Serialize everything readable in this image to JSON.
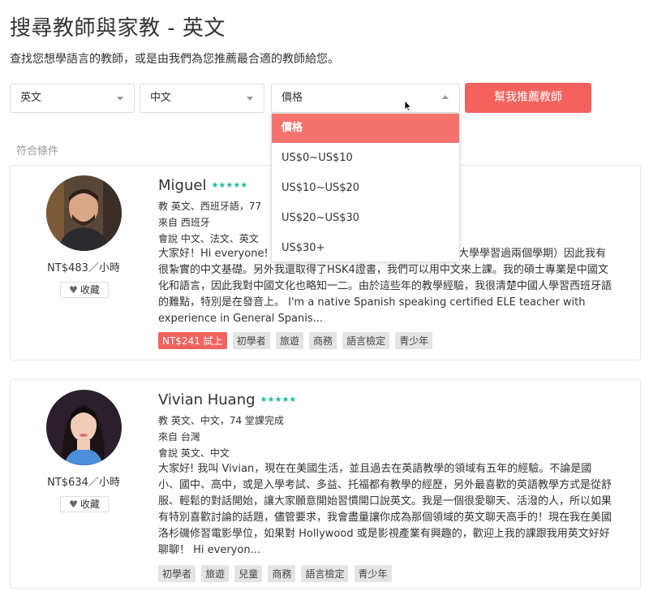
{
  "header": {
    "title": "搜尋教師與家教 - 英文",
    "subtitle": "查找您想學語言的教師，或是由我們為您推薦最合適的教師給您。"
  },
  "filters": {
    "language": "英文",
    "native": "中文",
    "price": "價格",
    "recommend_button": "幫我推薦教師",
    "price_options": [
      "價格",
      "US$0~US$10",
      "US$10~US$20",
      "US$20~US$30",
      "US$30+"
    ]
  },
  "results_label": "符合條件",
  "colors": {
    "accent": "#f4625e",
    "stars": "#1ebc9b"
  },
  "teachers": [
    {
      "name": "Miguel",
      "stars": "★★★★★",
      "teaches": "教 英文、西班牙語，77",
      "from": "來自  西班牙",
      "speaks": "會說  中文、法文、英文",
      "desc_l1": "大家好！Hi everyone!",
      "desc_l1b": "大學學習過兩個學期）因此我有",
      "desc_rest": "很紮實的中文基礎。另外我還取得了HSK4證書，我們可以用中文來上課。我的碩士專業是中國文化和語言，因此我對中國文化也略知一二。由於這些年的教學經驗，我很清楚中國人學習西班牙語的難點，特別是在發音上。  I'm a native Spanish speaking certified ELE teacher with experience in General Spanis...",
      "rate": "NT$483／小時",
      "fav": "收藏",
      "trial": "NT$241 試上",
      "tags": [
        "初學者",
        "旅遊",
        "商務",
        "語言檢定",
        "青少年"
      ]
    },
    {
      "name": "Vivian Huang",
      "stars": "★★★★★",
      "teaches": "教 英文、中文，74 堂課完成",
      "from": "來自  台灣",
      "speaks": "會說  英文、中文",
      "desc": "大家好! 我叫 Vivian，現在在美國生活，並且過去在英語教學的領域有五年的經驗。不論是國小、國中、高中，或是入學考試、多益、托福都有教學的經歷，另外最喜歡的英語教學方式是從舒服、輕鬆的對話開始，讓大家願意開始習慣開口說英文。我是一個很愛聊天、活潑的人，所以如果有特別喜歡討論的話題，儘管要求，我會盡量讓你成為那個領域的英文聊天高手的！現在我在美國洛杉磯修習電影學位，如果對 Hollywood 或是影視產業有興趣的，歡迎上我的課跟我用英文好好聊聊！  Hi everyon...",
      "rate": "NT$634／小時",
      "fav": "收藏",
      "tags": [
        "初學者",
        "旅遊",
        "兒童",
        "商務",
        "語言檢定",
        "青少年"
      ]
    }
  ]
}
